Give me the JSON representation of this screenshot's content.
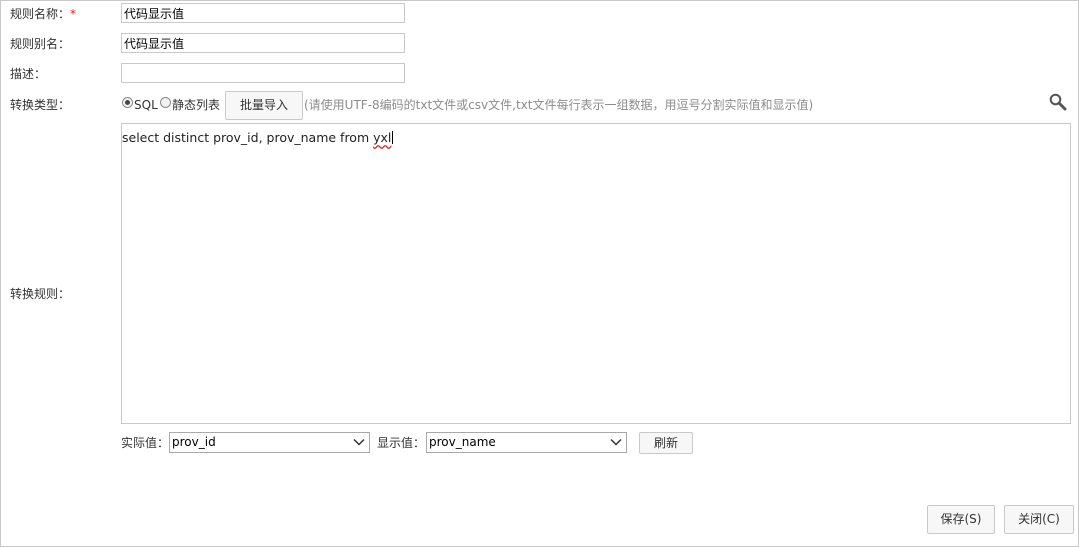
{
  "form": {
    "name_label": "规则名称：",
    "name_required": "*",
    "name_value": "代码显示值",
    "alias_label": "规则别名：",
    "alias_value": "代码显示值",
    "desc_label": "描述：",
    "desc_value": "",
    "type_label": "转换类型：",
    "type_options": [
      {
        "label": "SQL",
        "checked": true
      },
      {
        "label": "静态列表",
        "checked": false
      }
    ],
    "import_button": "批量导入",
    "import_hint": "(请使用UTF-8编码的txt文件或csv文件,txt文件每行表示一组数据，用逗号分割实际值和显示值)",
    "rule_label": "转换规则：",
    "sql_text_main": "select distinct prov_id, prov_name from ",
    "sql_text_tail": "yxl",
    "actual_label": "实际值：",
    "actual_value": "prov_id",
    "display_label": "显示值：",
    "display_value": "prov_name",
    "refresh_button": "刷新"
  },
  "footer": {
    "save_button": "保存(S)",
    "close_button": "关闭(C)"
  },
  "icons": {
    "search": "search-icon",
    "dropdown": "chevron-down-icon"
  },
  "colors": {
    "required": "#e02020",
    "hint": "#8c8c8c",
    "border": "#c9c9c9"
  }
}
